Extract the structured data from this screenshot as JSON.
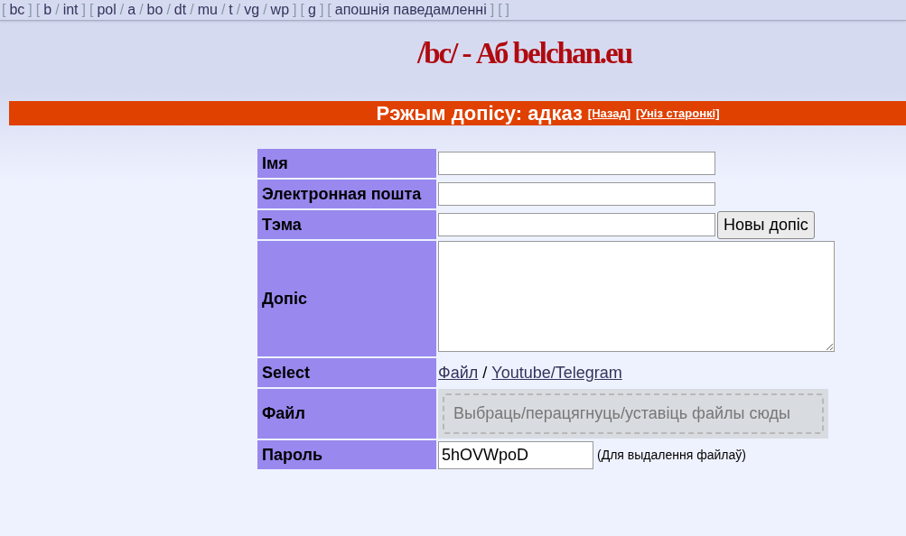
{
  "nav": [
    {
      "kind": "sep",
      "text": "["
    },
    {
      "kind": "link",
      "text": "bc"
    },
    {
      "kind": "sep",
      "text": "]"
    },
    {
      "kind": "sep",
      "text": "["
    },
    {
      "kind": "link",
      "text": "b"
    },
    {
      "kind": "sep",
      "text": "/"
    },
    {
      "kind": "link",
      "text": "int"
    },
    {
      "kind": "sep",
      "text": "]"
    },
    {
      "kind": "sep",
      "text": "["
    },
    {
      "kind": "link",
      "text": "pol"
    },
    {
      "kind": "sep",
      "text": "/"
    },
    {
      "kind": "link",
      "text": "a"
    },
    {
      "kind": "sep",
      "text": "/"
    },
    {
      "kind": "link",
      "text": "bo"
    },
    {
      "kind": "sep",
      "text": "/"
    },
    {
      "kind": "link",
      "text": "dt"
    },
    {
      "kind": "sep",
      "text": "/"
    },
    {
      "kind": "link",
      "text": "mu"
    },
    {
      "kind": "sep",
      "text": "/"
    },
    {
      "kind": "link",
      "text": "t"
    },
    {
      "kind": "sep",
      "text": "/"
    },
    {
      "kind": "link",
      "text": "vg"
    },
    {
      "kind": "sep",
      "text": "/"
    },
    {
      "kind": "link",
      "text": "wp"
    },
    {
      "kind": "sep",
      "text": "]"
    },
    {
      "kind": "sep",
      "text": "["
    },
    {
      "kind": "link",
      "text": "g"
    },
    {
      "kind": "sep",
      "text": "]"
    },
    {
      "kind": "sep",
      "text": "["
    },
    {
      "kind": "link",
      "text": "апошнія паведамленні"
    },
    {
      "kind": "sep",
      "text": "]"
    },
    {
      "kind": "sep",
      "text": "["
    },
    {
      "kind": "sep",
      "text": "]"
    }
  ],
  "board_title": "/bc/ - Аб belchan.eu",
  "mode_bar": {
    "text": "Рэжым допісу: адказ",
    "links": [
      "[Назад]",
      "[Уніз старонкі]"
    ]
  },
  "form": [
    {
      "kind": "text",
      "label": "Імя"
    },
    {
      "kind": "text",
      "label": "Электронная пошта"
    },
    {
      "kind": "text_button",
      "label": "Тэма",
      "button": "Новы допіс"
    },
    {
      "kind": "textarea",
      "label": "Допіс"
    },
    {
      "kind": "select",
      "label": "Select",
      "options": [
        "Файл",
        "Youtube/Telegram"
      ],
      "separator": "/"
    },
    {
      "kind": "drop",
      "label": "Файл",
      "placeholder": "Выбраць/перацягнуць/уставіць файлы сюды"
    },
    {
      "kind": "password",
      "label": "Пароль",
      "value": "5hOVWpoD",
      "note": "(Для выдалення файлаў)"
    }
  ]
}
